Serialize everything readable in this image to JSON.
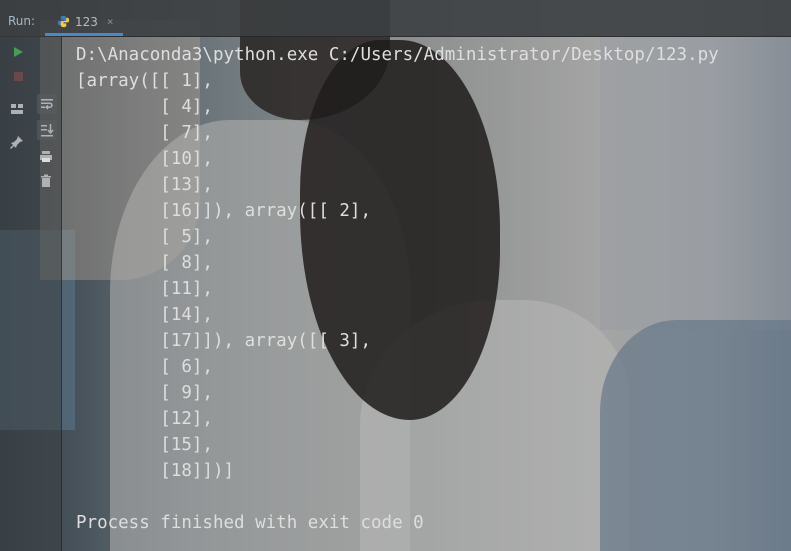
{
  "run_panel": {
    "label": "Run:",
    "tab": {
      "title": "123",
      "close_glyph": "×",
      "icon": "python-icon"
    }
  },
  "toolbar": {
    "buttons": [
      {
        "name": "run-icon",
        "color": "#499c54"
      },
      {
        "name": "stop-icon",
        "color": "#c75450"
      },
      {
        "name": "restore-layout-icon"
      },
      {
        "name": "soft-wrap-icon"
      },
      {
        "name": "pin-icon"
      },
      {
        "name": "scroll-to-end-icon"
      },
      {
        "name": "print-icon"
      },
      {
        "name": "trash-icon"
      }
    ]
  },
  "console": {
    "lines": [
      "D:\\Anaconda3\\python.exe C:/Users/Administrator/Desktop/123.py",
      "[array([[ 1],",
      "        [ 4],",
      "        [ 7],",
      "        [10],",
      "        [13],",
      "        [16]]), array([[ 2],",
      "        [ 5],",
      "        [ 8],",
      "        [11],",
      "        [14],",
      "        [17]]), array([[ 3],",
      "        [ 6],",
      "        [ 9],",
      "        [12],",
      "        [15],",
      "        [18]])]",
      "",
      "Process finished with exit code 0"
    ]
  },
  "colors": {
    "console_text": "#dedede",
    "tab_underline": "#4a88c7",
    "run_green": "#499c54"
  }
}
